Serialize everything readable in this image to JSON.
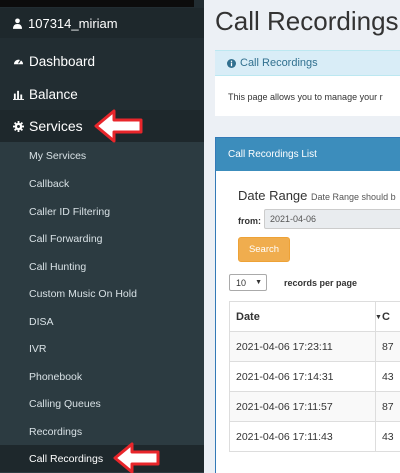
{
  "sidebar": {
    "username": "107314_miriam",
    "menu": [
      {
        "label": "Dashboard",
        "icon": "dashboard-icon"
      },
      {
        "label": "Balance",
        "icon": "bar-chart-icon"
      },
      {
        "label": "Services",
        "icon": "gear-icon"
      }
    ],
    "submenu": [
      "My Services",
      "Callback",
      "Caller ID Filtering",
      "Call Forwarding",
      "Call Hunting",
      "Custom Music On Hold",
      "DISA",
      "IVR",
      "Phonebook",
      "Calling Queues",
      "Recordings",
      "Call Recordings"
    ]
  },
  "main": {
    "title": "Call Recordings",
    "info": {
      "heading": "Call Recordings",
      "text": "This page allows you to manage your r"
    },
    "list": {
      "heading": "Call Recordings List",
      "date_range_title": "Date Range",
      "date_range_hint": "Date Range should b",
      "from_label": "from:",
      "from_value": "2021-04-06",
      "search_label": "Search",
      "per_page_value": "10",
      "per_page_label": "records per page",
      "columns": [
        "Date",
        "C"
      ],
      "rows": [
        {
          "date": "2021-04-06 17:23:11",
          "c": "87"
        },
        {
          "date": "2021-04-06 17:14:31",
          "c": "43"
        },
        {
          "date": "2021-04-06 17:11:57",
          "c": "87"
        },
        {
          "date": "2021-04-06 17:11:43",
          "c": "43"
        }
      ]
    }
  },
  "colors": {
    "sidebar_bg": "#222d32",
    "header_blue": "#3c8dbc",
    "search_orange": "#f0ad4e",
    "arrow_red": "#e8262b"
  }
}
